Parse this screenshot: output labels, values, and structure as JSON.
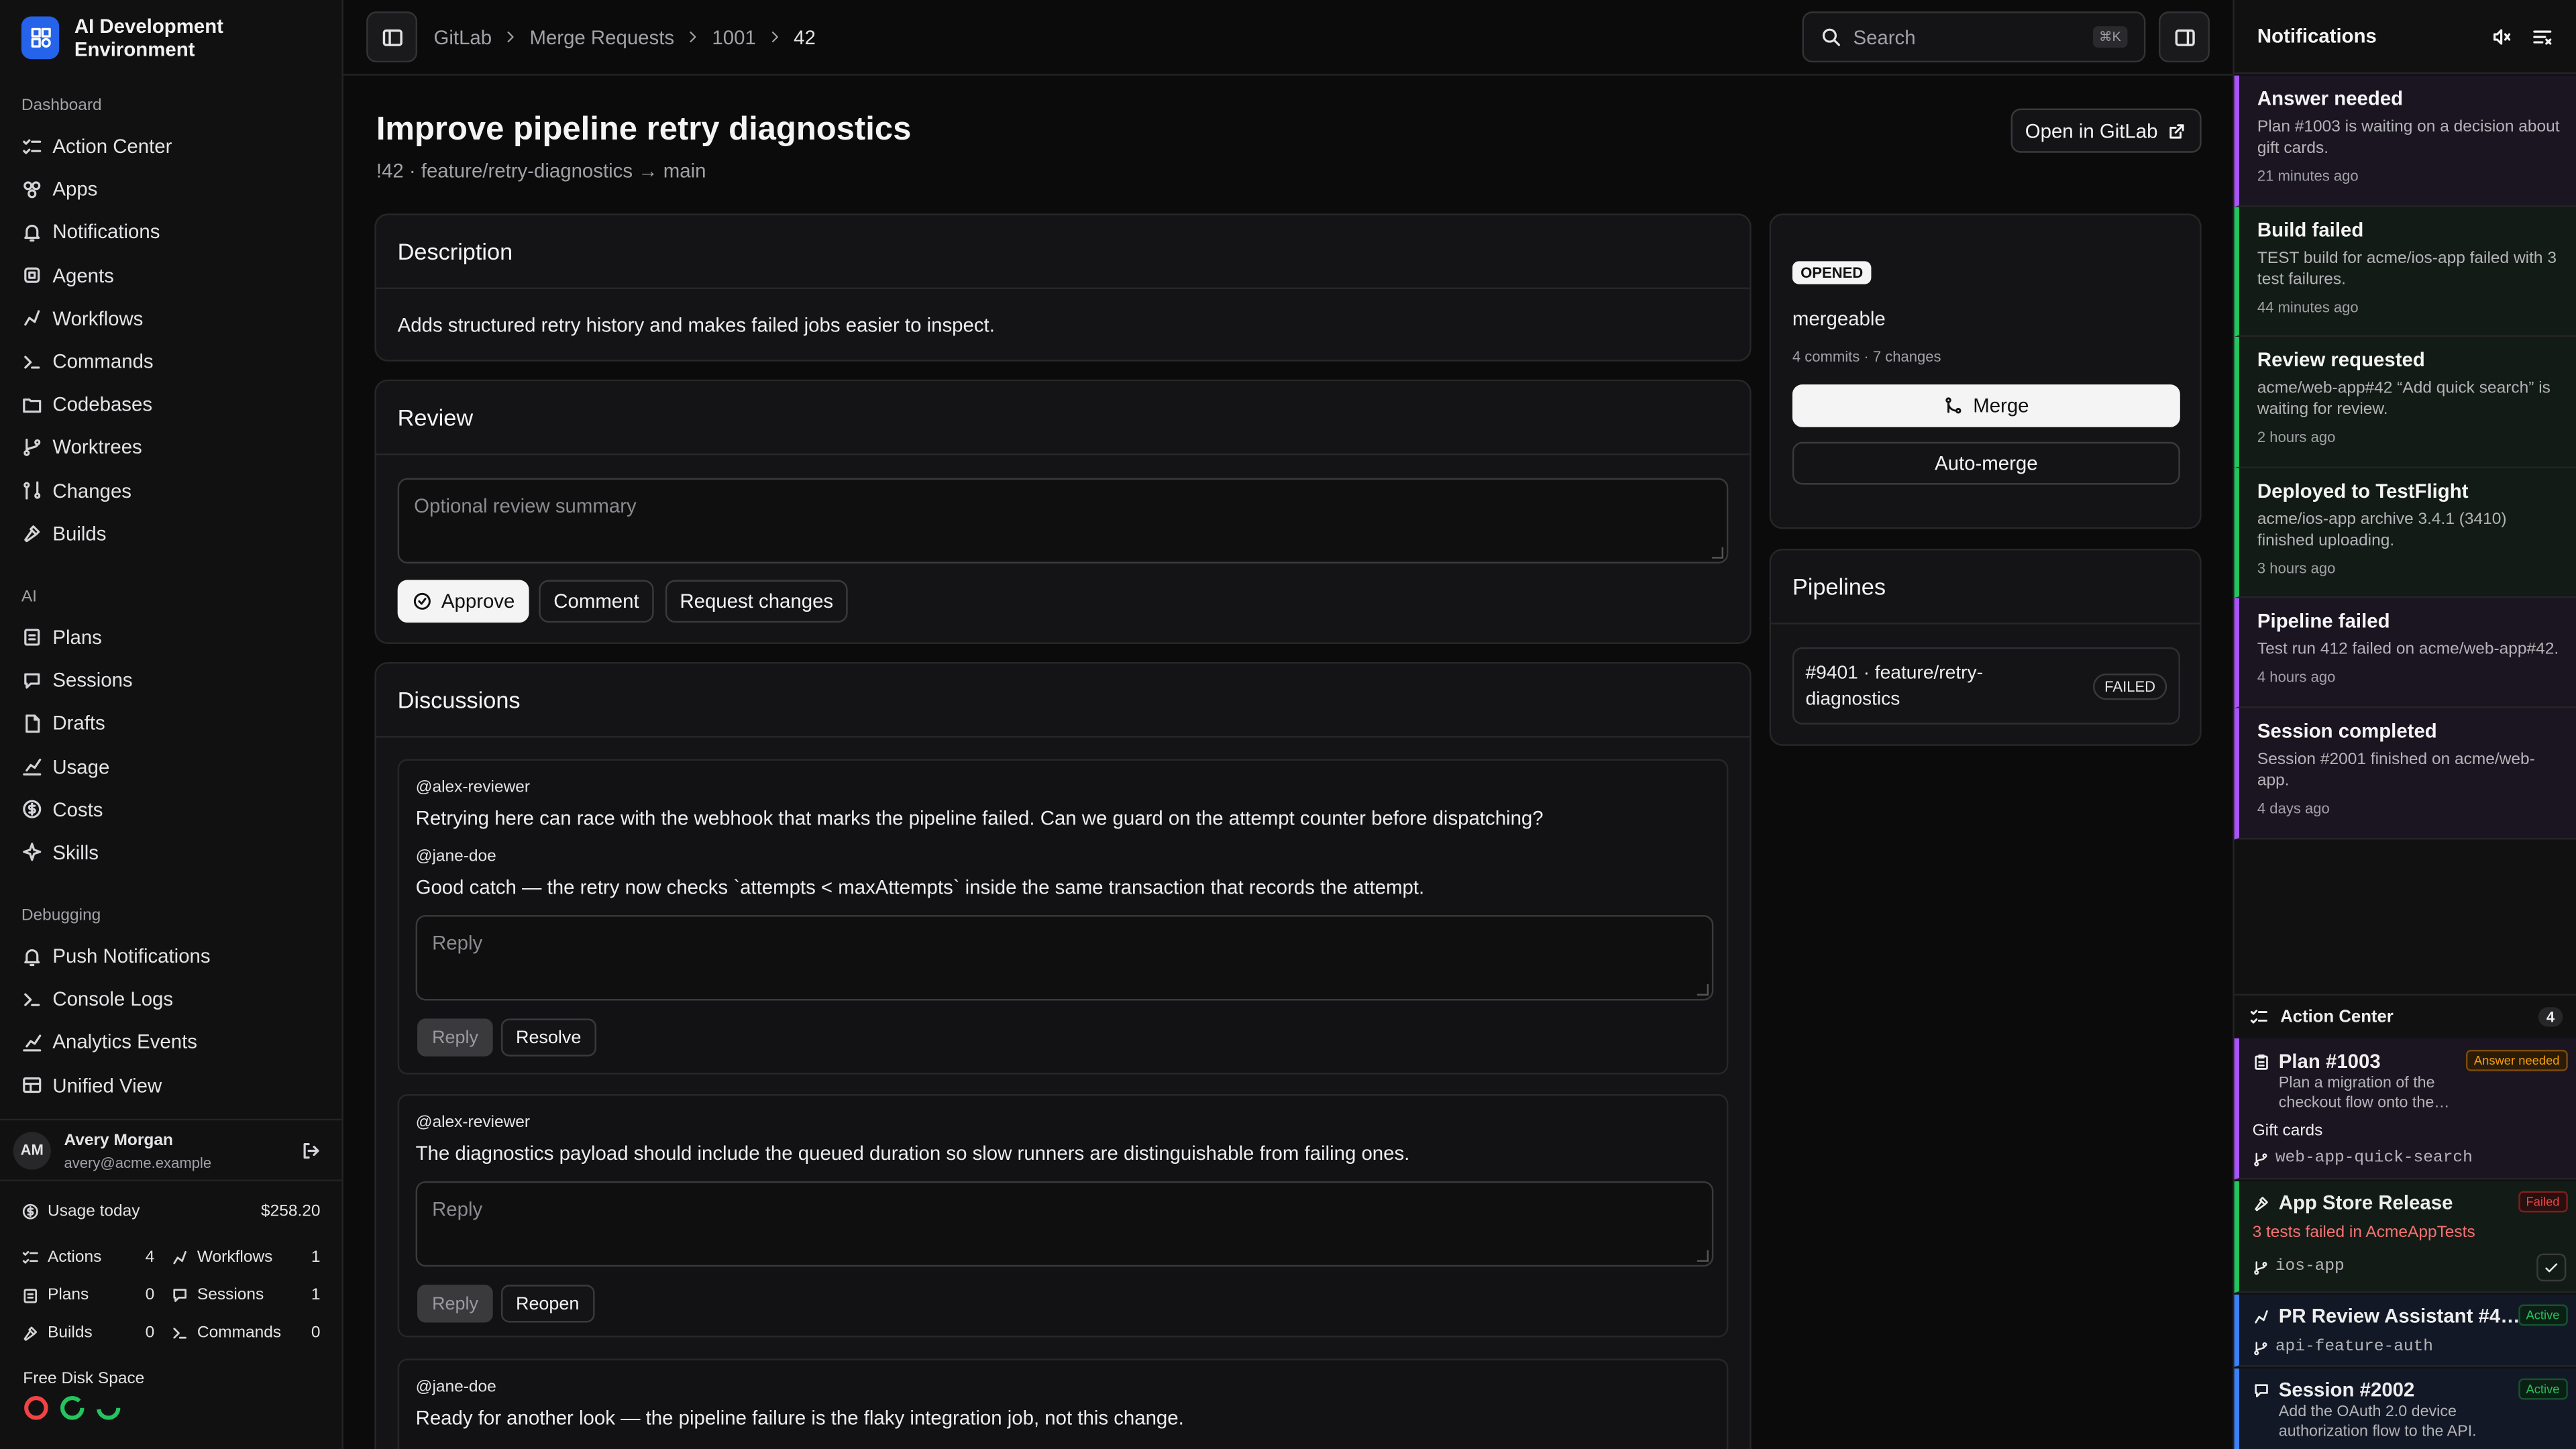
{
  "app": {
    "name": "AI Development Environment"
  },
  "sidebar": {
    "sections": [
      {
        "label": "Dashboard",
        "items": [
          "Action Center",
          "Apps",
          "Notifications",
          "Agents",
          "Workflows",
          "Commands",
          "Codebases",
          "Worktrees",
          "Changes",
          "Builds"
        ]
      },
      {
        "label": "AI",
        "items": [
          "Plans",
          "Sessions",
          "Drafts",
          "Usage",
          "Costs",
          "Skills"
        ]
      },
      {
        "label": "Debugging",
        "items": [
          "Push Notifications",
          "Console Logs",
          "Analytics Events",
          "Unified View"
        ]
      }
    ],
    "user": {
      "initials": "AM",
      "name": "Avery Morgan",
      "email": "avery@acme.example"
    },
    "usage": {
      "label": "Usage today",
      "value": "$258.20"
    },
    "stats": [
      [
        {
          "label": "Actions",
          "value": "4"
        },
        {
          "label": "Workflows",
          "value": "1"
        }
      ],
      [
        {
          "label": "Plans",
          "value": "0"
        },
        {
          "label": "Sessions",
          "value": "1"
        }
      ],
      [
        {
          "label": "Builds",
          "value": "0"
        },
        {
          "label": "Commands",
          "value": "0"
        }
      ]
    ],
    "disk": {
      "label": "Free Disk Space"
    }
  },
  "topbar": {
    "breadcrumb": [
      "GitLab",
      "Merge Requests",
      "1001",
      "42"
    ],
    "search": {
      "placeholder": "Search",
      "shortcut": "⌘K"
    }
  },
  "mr": {
    "title": "Improve pipeline retry diagnostics",
    "subtitle": "!42 · feature/retry-diagnostics → main",
    "open_button": "Open in GitLab",
    "description": {
      "heading": "Description",
      "text": "Adds structured retry history and makes failed jobs easier to inspect."
    },
    "review": {
      "heading": "Review",
      "placeholder": "Optional review summary",
      "approve": "Approve",
      "comment": "Comment",
      "request_changes": "Request changes"
    },
    "discussions": {
      "heading": "Discussions",
      "threads": [
        {
          "notes": [
            {
              "author": "@alex-reviewer",
              "text": "Retrying here can race with the webhook that marks the pipeline failed. Can we guard on the attempt counter before dispatching?"
            },
            {
              "author": "@jane-doe",
              "text": "Good catch — the retry now checks `attempts < maxAttempts` inside the same transaction that records the attempt."
            }
          ],
          "reply_placeholder": "Reply",
          "reply": "Reply",
          "action": "Resolve"
        },
        {
          "notes": [
            {
              "author": "@alex-reviewer",
              "text": "The diagnostics payload should include the queued duration so slow runners are distinguishable from failing ones."
            }
          ],
          "reply_placeholder": "Reply",
          "reply": "Reply",
          "action": "Reopen"
        },
        {
          "notes": [
            {
              "author": "@jane-doe",
              "text": "Ready for another look — the pipeline failure is the flaky integration job, not this change."
            }
          ]
        }
      ]
    },
    "status": {
      "state": "OPENED",
      "merge_status": "mergeable",
      "counts": "4 commits · 7 changes",
      "merge": "Merge",
      "auto_merge": "Auto-merge"
    },
    "pipelines": {
      "heading": "Pipelines",
      "items": [
        {
          "label": "#9401 · feature/retry-diagnostics",
          "status": "FAILED"
        }
      ]
    }
  },
  "notifications": {
    "heading": "Notifications",
    "items": [
      {
        "title": "Answer needed",
        "text": "Plan #1003 is waiting on a decision about gift cards.",
        "age": "21 minutes ago",
        "color": "#a855f7",
        "bg": "#1b1522"
      },
      {
        "title": "Build failed",
        "text": "TEST build for acme/ios-app failed with 3 test failures.",
        "age": "44 minutes ago",
        "color": "#22c55e",
        "bg": "#131b16"
      },
      {
        "title": "Review requested",
        "text": "acme/web-app#42 “Add quick search” is waiting for review.",
        "age": "2 hours ago",
        "color": "#22c55e",
        "bg": "#131b16"
      },
      {
        "title": "Deployed to TestFlight",
        "text": "acme/ios-app archive 3.4.1 (3410) finished uploading.",
        "age": "3 hours ago",
        "color": "#22c55e",
        "bg": "#131b16"
      },
      {
        "title": "Pipeline failed",
        "text": "Test run 412 failed on acme/web-app#42.",
        "age": "4 hours ago",
        "color": "#a855f7",
        "bg": "#1b1522"
      },
      {
        "title": "Session completed",
        "text": "Session #2001 finished on acme/web-app.",
        "age": "4 days ago",
        "color": "#a855f7",
        "bg": "#1b1522"
      }
    ]
  },
  "action_center": {
    "heading": "Action Center",
    "count": "4",
    "items": [
      {
        "title": "Plan #1003",
        "badge": "Answer needed",
        "badge_color": "#f59e0b",
        "text": "Plan a migration of the checkout flow onto the…",
        "extra": "Gift cards",
        "branch": "web-app-quick-search",
        "color": "#a855f7"
      },
      {
        "title": "App Store Release",
        "badge": "Failed",
        "badge_color": "#ef4444",
        "text": "3 tests failed in AcmeAppTests",
        "branch": "ios-app",
        "color": "#22c55e"
      },
      {
        "title": "PR Review Assistant #4…",
        "badge": "Active",
        "badge_color": "#22c55e",
        "branch": "api-feature-auth",
        "color": "#3b82f6"
      },
      {
        "title": "Session #2002",
        "badge": "Active",
        "badge_color": "#22c55e",
        "text": "Add the OAuth 2.0 device authorization flow to the API.",
        "color": "#3b82f6"
      }
    ]
  }
}
